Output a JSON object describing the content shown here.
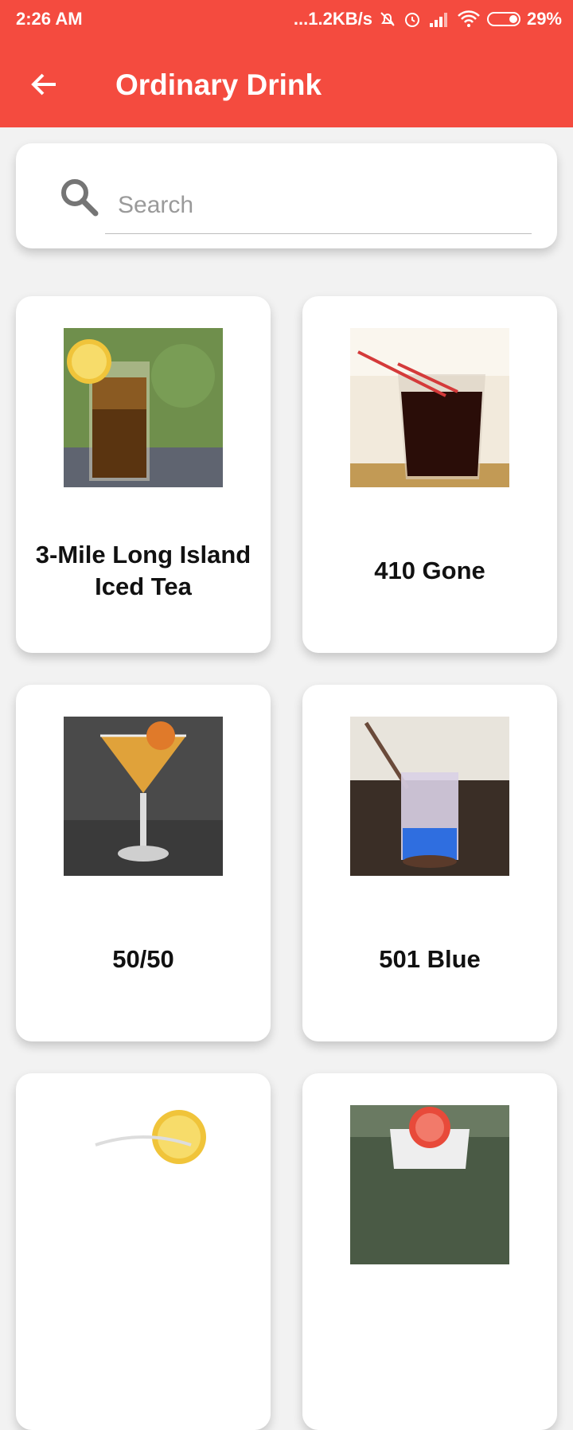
{
  "status_bar": {
    "time": "2:26 AM",
    "network_speed": "...1.2KB/s",
    "battery": "29%",
    "icons": [
      "bell-off-icon",
      "alarm-icon",
      "signal-icon",
      "wifi-icon",
      "battery-icon"
    ]
  },
  "app_bar": {
    "title": "Ordinary Drink",
    "back_icon": "arrow-left-icon",
    "color": "#f44b3f"
  },
  "search": {
    "placeholder": "Search",
    "value": "",
    "icon": "search-icon"
  },
  "drinks": [
    {
      "name": "3-Mile Long Island Iced Tea"
    },
    {
      "name": "410 Gone"
    },
    {
      "name": "50/50"
    },
    {
      "name": "501 Blue"
    }
  ]
}
